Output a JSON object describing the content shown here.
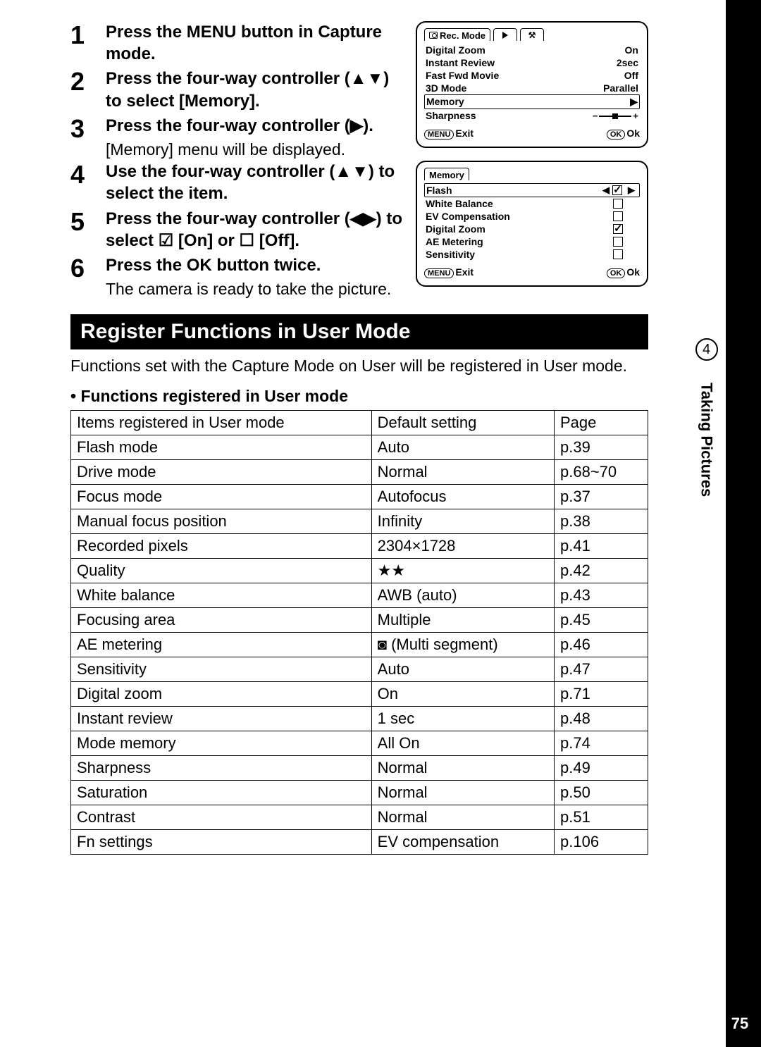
{
  "steps": [
    {
      "num": "1",
      "bold": "Press the MENU button in Capture mode.",
      "plain": ""
    },
    {
      "num": "2",
      "bold": "Press the four-way controller (▲▼) to select [Memory].",
      "plain": ""
    },
    {
      "num": "3",
      "bold": "Press the four-way controller (▶).",
      "plain": "[Memory] menu will be displayed."
    },
    {
      "num": "4",
      "bold": "Use the four-way controller (▲▼) to select the item.",
      "plain": ""
    },
    {
      "num": "5",
      "bold": "Press the four-way controller (◀▶) to select ☑ [On] or ☐ [Off].",
      "plain": ""
    },
    {
      "num": "6",
      "bold": "Press the OK button twice.",
      "plain": "The camera is ready to take the picture."
    }
  ],
  "lcd1": {
    "tab_main": "Rec. Mode",
    "rows": [
      {
        "label": "Digital Zoom",
        "value": "On"
      },
      {
        "label": "Instant Review",
        "value": "2sec"
      },
      {
        "label": "Fast Fwd Movie",
        "value": "Off"
      },
      {
        "label": "3D Mode",
        "value": "Parallel"
      },
      {
        "label": "Memory",
        "value": "▶",
        "highlight": true
      },
      {
        "label": "Sharpness",
        "value": "slider"
      }
    ],
    "foot_left_pill": "MENU",
    "foot_left": "Exit",
    "foot_right_pill": "OK",
    "foot_right": "Ok"
  },
  "lcd2": {
    "title": "Memory",
    "rows": [
      {
        "label": "Flash",
        "checked": true,
        "highlight": true,
        "arrows": true
      },
      {
        "label": "White Balance",
        "checked": false
      },
      {
        "label": "EV Compensation",
        "checked": false
      },
      {
        "label": "Digital Zoom",
        "checked": true
      },
      {
        "label": "AE Metering",
        "checked": false
      },
      {
        "label": "Sensitivity",
        "checked": false
      }
    ],
    "foot_left_pill": "MENU",
    "foot_left": "Exit",
    "foot_right_pill": "OK",
    "foot_right": "Ok"
  },
  "section": {
    "title": "Register Functions in User Mode",
    "desc": "Functions set with the Capture Mode on User will be registered in User mode.",
    "subhead": "• Functions registered in User mode"
  },
  "table": {
    "headers": [
      "Items registered in User mode",
      "Default setting",
      "Page"
    ],
    "rows": [
      [
        "Flash mode",
        "Auto",
        "p.39"
      ],
      [
        "Drive mode",
        "Normal",
        "p.68~70"
      ],
      [
        "Focus mode",
        "Autofocus",
        "p.37"
      ],
      [
        "Manual focus position",
        "Infinity",
        "p.38"
      ],
      [
        "Recorded pixels",
        "2304×1728",
        "p.41"
      ],
      [
        "Quality",
        "★★",
        "p.42"
      ],
      [
        "White balance",
        "AWB (auto)",
        "p.43"
      ],
      [
        "Focusing area",
        "Multiple",
        "p.45"
      ],
      [
        "AE metering",
        "◙ (Multi segment)",
        "p.46"
      ],
      [
        "Sensitivity",
        "Auto",
        "p.47"
      ],
      [
        "Digital zoom",
        "On",
        "p.71"
      ],
      [
        "Instant review",
        "1 sec",
        "p.48"
      ],
      [
        "Mode memory",
        "All On",
        "p.74"
      ],
      [
        "Sharpness",
        "Normal",
        "p.49"
      ],
      [
        "Saturation",
        "Normal",
        "p.50"
      ],
      [
        "Contrast",
        "Normal",
        "p.51"
      ],
      [
        "Fn settings",
        "EV compensation",
        "p.106"
      ]
    ]
  },
  "sidetab": {
    "num": "4",
    "label": "Taking Pictures"
  },
  "page_number": "75"
}
